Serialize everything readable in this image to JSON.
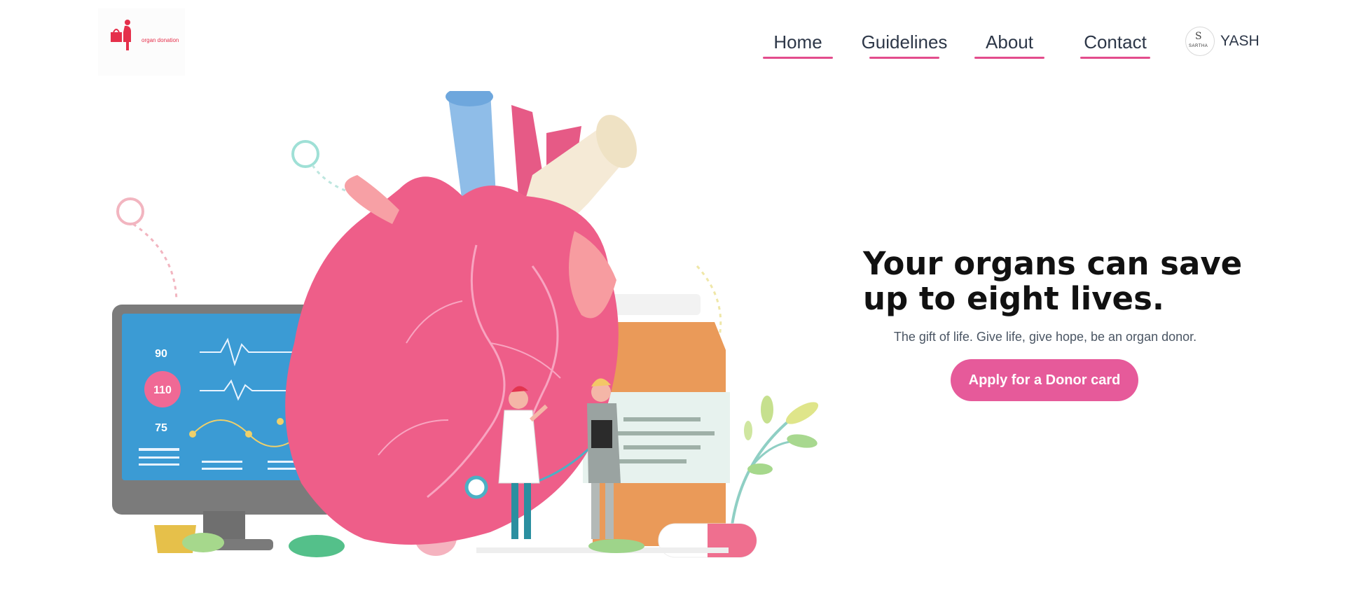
{
  "brand": {
    "logo_text": "organ donation"
  },
  "nav": {
    "items": [
      {
        "label": "Home"
      },
      {
        "label": "Guidelines"
      },
      {
        "label": "About"
      },
      {
        "label": "Contact"
      }
    ]
  },
  "user": {
    "name": "YASH",
    "avatar_letter": "S",
    "avatar_text": "SARTHA"
  },
  "hero": {
    "headline": "Your organs can save up to eight lives.",
    "subtitle": "The gift of life. Give life, give hope, be an organ donor.",
    "cta_label": "Apply for a Donor card",
    "monitor_readings": [
      "90",
      "110",
      "75"
    ]
  },
  "colors": {
    "accent": "#e65a9a",
    "brand_red": "#e5304b",
    "text": "#2d3748"
  }
}
